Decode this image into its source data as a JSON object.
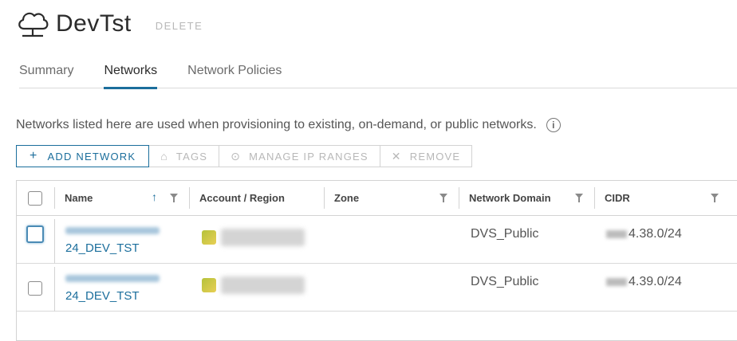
{
  "header": {
    "title": "DevTst",
    "delete_label": "DELETE",
    "icon": "cloud-icon"
  },
  "tabs": [
    {
      "label": "Summary",
      "active": false
    },
    {
      "label": "Networks",
      "active": true
    },
    {
      "label": "Network Policies",
      "active": false
    }
  ],
  "description": "Networks listed here are used when provisioning to existing, on-demand, or public networks.",
  "toolbar": {
    "add_network": "ADD NETWORK",
    "tags": "TAGS",
    "manage_ip_ranges": "MANAGE IP RANGES",
    "remove": "REMOVE"
  },
  "table": {
    "columns": [
      "Name",
      "Account / Region",
      "Zone",
      "Network Domain",
      "CIDR"
    ],
    "rows": [
      {
        "name_suffix": "24_DEV_TST",
        "zone": "",
        "network_domain": "DVS_Public",
        "cidr_suffix": "4.38.0/24"
      },
      {
        "name_suffix": "24_DEV_TST",
        "zone": "",
        "network_domain": "DVS_Public",
        "cidr_suffix": "4.39.0/24"
      }
    ]
  },
  "colors": {
    "accent": "#1b6e9c",
    "border": "#d3d3d3",
    "disabled": "#b8b8b8"
  }
}
